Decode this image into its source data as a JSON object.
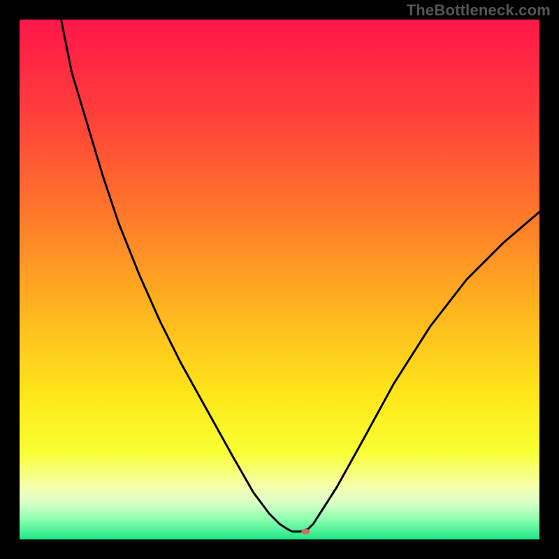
{
  "watermark": "TheBottleneck.com",
  "chart_data": {
    "type": "line",
    "title": "",
    "xlabel": "",
    "ylabel": "",
    "xlim": [
      0,
      100
    ],
    "ylim": [
      0,
      100
    ],
    "grid": false,
    "legend": false,
    "annotations": [],
    "background_gradient_stops": [
      {
        "offset": 0.0,
        "color": "#ff1649"
      },
      {
        "offset": 0.18,
        "color": "#ff3e3b"
      },
      {
        "offset": 0.38,
        "color": "#ff7a2a"
      },
      {
        "offset": 0.55,
        "color": "#ffb21f"
      },
      {
        "offset": 0.72,
        "color": "#ffe61a"
      },
      {
        "offset": 0.83,
        "color": "#f8ff30"
      },
      {
        "offset": 0.9,
        "color": "#f5ffb0"
      },
      {
        "offset": 0.93,
        "color": "#d8ffc8"
      },
      {
        "offset": 0.96,
        "color": "#8fffb0"
      },
      {
        "offset": 1.0,
        "color": "#1fe688"
      }
    ],
    "series": [
      {
        "name": "curve",
        "color": "#000000",
        "x": [
          8,
          10,
          13,
          16,
          19,
          23,
          27,
          31,
          36,
          41,
          45,
          48,
          50,
          51.5,
          52.5,
          54,
          55.5,
          56.5,
          61,
          66,
          72,
          79,
          86,
          93,
          100
        ],
        "y": [
          100,
          90,
          80,
          70,
          61,
          51,
          42,
          34,
          25,
          16,
          9,
          5,
          3,
          2,
          1.5,
          1.5,
          2,
          3,
          10,
          19,
          30,
          41,
          50,
          57,
          63
        ]
      }
    ],
    "marker": {
      "x": 55,
      "y": 1.5,
      "color": "#c96f65",
      "rx": 6,
      "ry": 4
    }
  }
}
